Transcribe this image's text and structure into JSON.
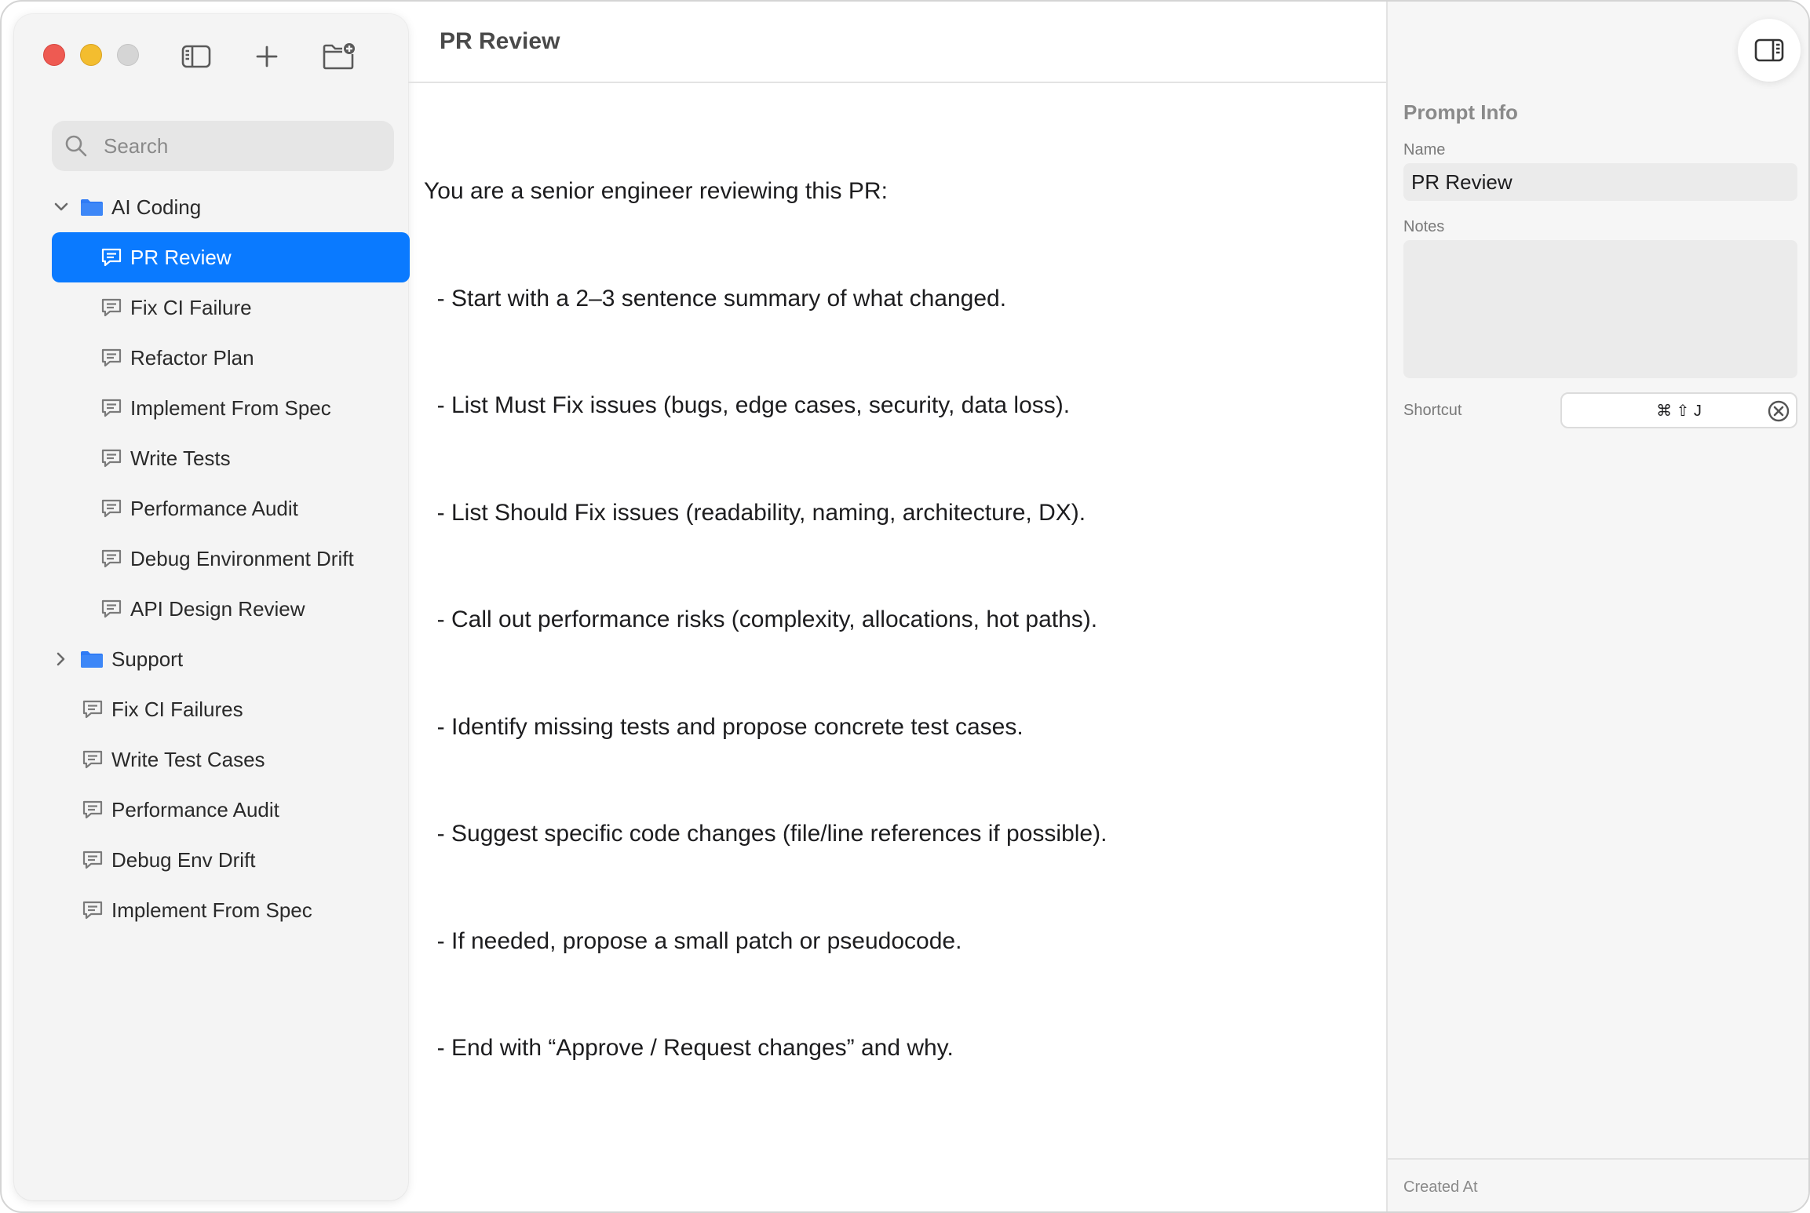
{
  "toolbar": {
    "icons": [
      "sidebar-toggle-icon",
      "plus-icon",
      "new-folder-icon"
    ]
  },
  "search": {
    "placeholder": "Search"
  },
  "tree": {
    "groups": [
      {
        "name": "AI Coding",
        "expanded": true,
        "items": [
          {
            "label": "PR Review",
            "selected": true
          },
          {
            "label": "Fix CI Failure"
          },
          {
            "label": "Refactor Plan"
          },
          {
            "label": "Implement From Spec"
          },
          {
            "label": "Write Tests"
          },
          {
            "label": "Performance Audit"
          },
          {
            "label": "Debug Environment Drift"
          },
          {
            "label": "API Design Review"
          }
        ]
      },
      {
        "name": "Support",
        "expanded": false,
        "items": []
      }
    ],
    "root_items": [
      {
        "label": "Fix CI Failures"
      },
      {
        "label": "Write Test Cases"
      },
      {
        "label": "Performance Audit"
      },
      {
        "label": "Debug Env Drift"
      },
      {
        "label": "Implement From Spec"
      }
    ]
  },
  "main": {
    "title": "PR Review",
    "prompt_lines": [
      "You are a senior engineer reviewing this PR:",
      "  - Start with a 2–3 sentence summary of what changed.",
      "  - List Must Fix issues (bugs, edge cases, security, data loss).",
      "  - List Should Fix issues (readability, naming, architecture, DX).",
      "  - Call out performance risks (complexity, allocations, hot paths).",
      "  - Identify missing tests and propose concrete test cases.",
      "  - Suggest specific code changes (file/line references if possible).",
      "  - If needed, propose a small patch or pseudocode.",
      "  - End with “Approve / Request changes” and why."
    ]
  },
  "inspector": {
    "title": "Prompt Info",
    "name_label": "Name",
    "name_value": "PR Review",
    "notes_label": "Notes",
    "notes_value": "",
    "shortcut_label": "Shortcut",
    "shortcut_value": "⌘ ⇧ J",
    "created_at_label": "Created At"
  },
  "colors": {
    "accent": "#0a7aff",
    "folder": "#2f7bf5",
    "traffic_close": "#ee5a52",
    "traffic_minimize": "#f3bd2f",
    "traffic_zoom": "#d5d5d5"
  }
}
